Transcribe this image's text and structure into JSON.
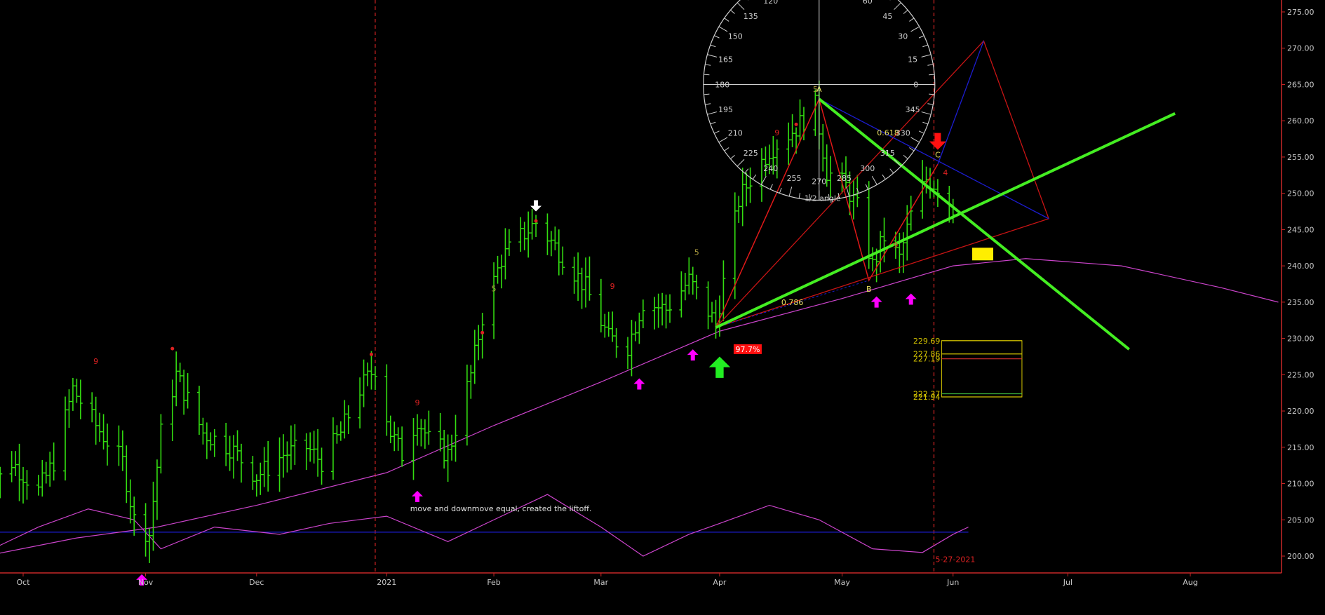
{
  "chart_data": {
    "type": "bar",
    "y_axis": {
      "ylim": [
        197.5,
        277.0
      ],
      "ticks": [
        "200.00",
        "205.00",
        "210.00",
        "215.00",
        "220.00",
        "225.00",
        "230.00",
        "235.00",
        "240.00",
        "245.00",
        "250.00",
        "255.00",
        "260.00",
        "265.00",
        "270.00",
        "275.00"
      ]
    },
    "x_axis": {
      "labels": [
        {
          "label": "Oct",
          "date": "2020-10-01"
        },
        {
          "label": "Nov",
          "date": "2020-11-02"
        },
        {
          "label": "Dec",
          "date": "2020-12-01"
        },
        {
          "label": "2021",
          "date": "2021-01-04"
        },
        {
          "label": "Feb",
          "date": "2021-02-01"
        },
        {
          "label": "Mar",
          "date": "2021-03-01"
        },
        {
          "label": "Apr",
          "date": "2021-04-01"
        },
        {
          "label": "May",
          "date": "2021-05-03"
        },
        {
          "label": "Jun",
          "date": "2021-06-01"
        },
        {
          "label": "Jul",
          "date": "2021-07-01"
        },
        {
          "label": "Aug",
          "date": "2021-08-02"
        }
      ]
    },
    "price_path": [
      [
        "2020-09-21",
        208
      ],
      [
        "2020-09-28",
        213
      ],
      [
        "2020-10-05",
        209
      ],
      [
        "2020-10-09",
        213
      ],
      [
        "2020-10-14",
        223
      ],
      [
        "2020-10-20",
        218
      ],
      [
        "2020-10-27",
        213
      ],
      [
        "2020-10-30",
        205
      ],
      [
        "2020-11-03",
        203
      ],
      [
        "2020-11-06",
        217
      ],
      [
        "2020-11-10",
        225
      ],
      [
        "2020-11-17",
        217
      ],
      [
        "2020-11-24",
        215
      ],
      [
        "2020-12-01",
        211
      ],
      [
        "2020-12-08",
        214
      ],
      [
        "2020-12-14",
        215
      ],
      [
        "2020-12-18",
        213
      ],
      [
        "2020-12-23",
        217
      ],
      [
        "2020-12-28",
        223
      ],
      [
        "2021-01-01",
        226
      ],
      [
        "2021-01-05",
        217
      ],
      [
        "2021-01-08",
        214
      ],
      [
        "2021-01-12",
        219
      ],
      [
        "2021-01-15",
        216
      ],
      [
        "2021-01-20",
        214
      ],
      [
        "2021-01-26",
        225
      ],
      [
        "2021-01-29",
        233
      ],
      [
        "2021-02-03",
        241
      ],
      [
        "2021-02-08",
        244
      ],
      [
        "2021-02-12",
        246
      ],
      [
        "2021-02-18",
        242
      ],
      [
        "2021-02-25",
        237
      ],
      [
        "2021-03-03",
        230
      ],
      [
        "2021-03-08",
        229
      ],
      [
        "2021-03-12",
        235
      ],
      [
        "2021-03-18",
        234
      ],
      [
        "2021-03-24",
        238
      ],
      [
        "2021-03-31",
        232
      ],
      [
        "2021-04-06",
        249
      ],
      [
        "2021-04-09",
        252
      ],
      [
        "2021-04-14",
        256
      ],
      [
        "2021-04-21",
        259
      ],
      [
        "2021-04-26",
        262
      ],
      [
        "2021-04-29",
        253
      ],
      [
        "2021-05-04",
        251
      ],
      [
        "2021-05-07",
        248
      ],
      [
        "2021-05-11",
        240
      ],
      [
        "2021-05-14",
        244
      ],
      [
        "2021-05-18",
        241
      ],
      [
        "2021-05-21",
        247
      ],
      [
        "2021-05-25",
        252
      ],
      [
        "2021-05-28",
        251
      ],
      [
        "2021-06-01",
        248
      ]
    ],
    "moving_average_line": [
      [
        "2020-09-21",
        200
      ],
      [
        "2020-10-15",
        202.5
      ],
      [
        "2020-11-05",
        204
      ],
      [
        "2020-12-01",
        207
      ],
      [
        "2021-01-04",
        211.5
      ],
      [
        "2021-02-01",
        218
      ],
      [
        "2021-03-01",
        224
      ],
      [
        "2021-04-01",
        231
      ],
      [
        "2021-05-03",
        235.5
      ],
      [
        "2021-06-01",
        240
      ],
      [
        "2021-06-20",
        241
      ],
      [
        "2021-07-15",
        240
      ],
      [
        "2021-08-10",
        237
      ],
      [
        "2021-08-25",
        235
      ]
    ],
    "oscillator_line": [
      [
        "2020-09-21",
        200.5
      ],
      [
        "2020-10-05",
        204
      ],
      [
        "2020-10-18",
        206.5
      ],
      [
        "2020-10-30",
        205
      ],
      [
        "2020-11-06",
        201
      ],
      [
        "2020-11-20",
        204
      ],
      [
        "2020-12-07",
        203
      ],
      [
        "2020-12-20",
        204.5
      ],
      [
        "2021-01-04",
        205.5
      ],
      [
        "2021-01-20",
        202
      ],
      [
        "2021-02-01",
        205
      ],
      [
        "2021-02-15",
        208.5
      ],
      [
        "2021-03-01",
        204
      ],
      [
        "2021-03-12",
        200
      ],
      [
        "2021-03-24",
        203
      ],
      [
        "2021-04-01",
        204.5
      ],
      [
        "2021-04-14",
        207
      ],
      [
        "2021-04-27",
        205
      ],
      [
        "2021-05-11",
        201
      ],
      [
        "2021-05-24",
        200.5
      ],
      [
        "2021-06-01",
        203
      ],
      [
        "2021-06-05",
        204
      ]
    ],
    "horizontal_lines": [
      {
        "value": 203.3,
        "color": "#1c1ccf"
      }
    ],
    "vertical_lines": [
      {
        "date": "2021-01-01",
        "color": "#c02020"
      },
      {
        "date": "2021-05-27",
        "color": "#c02020"
      }
    ],
    "harmonic_pattern": {
      "points": [
        {
          "label": "A",
          "date": "2021-04-27",
          "value": 263
        },
        {
          "label": "B",
          "date": "2021-05-10",
          "value": 238
        },
        {
          "label": "C",
          "date": "2021-05-28",
          "value": 254
        }
      ],
      "ratios": [
        "0.618",
        "0.786"
      ]
    },
    "green_trendlines": [
      {
        "from": [
          "2021-03-31",
          231.5
        ],
        "to": [
          "2021-07-29",
          261
        ]
      },
      {
        "from": [
          "2021-04-27",
          263
        ],
        "to": [
          "2021-07-17",
          228.5
        ]
      }
    ],
    "price_levels": [
      "229.69",
      "227.86",
      "227.19",
      "222.37",
      "221.94"
    ],
    "annotations": [
      "97.7%",
      "move and downmove equal, created the liftoff.",
      "1/2 angle",
      "5-27-2021"
    ],
    "bar_markers": [
      {
        "text": "9",
        "date": "2020-10-20",
        "value": 226.5
      },
      {
        "text": "9",
        "date": "2021-01-12",
        "value": 220.8
      },
      {
        "text": "5",
        "date": "2021-02-01",
        "value": 236.5
      },
      {
        "text": "9",
        "date": "2021-03-04",
        "value": 236.8
      },
      {
        "text": "5",
        "date": "2021-03-26",
        "value": 241.5
      },
      {
        "text": "9",
        "date": "2021-04-16",
        "value": 258
      },
      {
        "text": "5",
        "date": "2021-04-26",
        "value": 264
      },
      {
        "text": "4",
        "date": "2021-05-30",
        "value": 252.5
      },
      {
        "text": "9",
        "date": "2021-05-17",
        "value": 242.5
      }
    ],
    "signal_arrows": [
      {
        "color": "magenta",
        "direction": "up",
        "date": "2020-11-01",
        "value": 197.5
      },
      {
        "color": "magenta",
        "direction": "up",
        "date": "2021-01-12",
        "value": 209
      },
      {
        "color": "magenta",
        "direction": "up",
        "date": "2021-03-11",
        "value": 224.5
      },
      {
        "color": "magenta",
        "direction": "up",
        "date": "2021-03-25",
        "value": 228.5
      },
      {
        "color": "magenta",
        "direction": "up",
        "date": "2021-05-12",
        "value": 235.8
      },
      {
        "color": "magenta",
        "direction": "up",
        "date": "2021-05-21",
        "value": 236.2
      },
      {
        "color": "green",
        "direction": "up",
        "date": "2021-04-01",
        "value": 227.5
      },
      {
        "color": "white",
        "direction": "down",
        "date": "2021-02-12",
        "value": 247.5
      },
      {
        "color": "red",
        "direction": "down",
        "date": "2021-05-28",
        "value": 256
      }
    ],
    "colors": {
      "background": "#000000",
      "price_bars": "#33dd11",
      "moving_average": "#cc44cc",
      "oscillator": "#cc44cc",
      "trendlines": "#44ee22",
      "pattern_lines": "#e01818",
      "pattern_box": "#c81414",
      "blue_lines": "#1c1ccf",
      "price_box": "#d4c400",
      "axis": "#c82828",
      "text": "#c8c8c8",
      "highlight_box": "#ffee00"
    },
    "circle_tool": {
      "angle_labels": [
        "0",
        "15",
        "30",
        "45",
        "60",
        "120",
        "135",
        "150",
        "165",
        "180",
        "195",
        "210",
        "225",
        "240",
        "255",
        "270",
        "285",
        "300",
        "315",
        "330",
        "345"
      ]
    }
  }
}
